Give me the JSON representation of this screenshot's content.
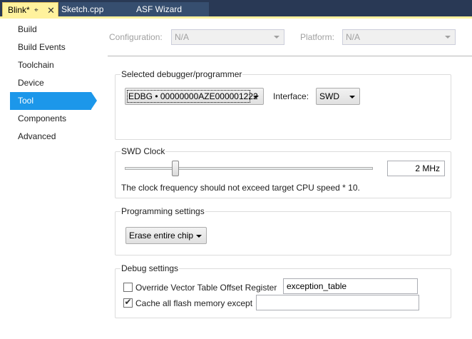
{
  "tabs": [
    {
      "label": "Blink*",
      "pin_icon": "pin-icon",
      "close_icon": "close-icon"
    },
    {
      "label": "Sketch.cpp"
    },
    {
      "label": "ASF Wizard"
    }
  ],
  "nav": {
    "items": [
      {
        "label": "Build"
      },
      {
        "label": "Build Events"
      },
      {
        "label": "Toolchain"
      },
      {
        "label": "Device"
      },
      {
        "label": "Tool"
      },
      {
        "label": "Components"
      },
      {
        "label": "Advanced"
      }
    ],
    "selected": "Tool"
  },
  "top": {
    "configuration_label": "Configuration:",
    "configuration_value": "N/A",
    "platform_label": "Platform:",
    "platform_value": "N/A"
  },
  "debugger": {
    "title": "Selected debugger/programmer",
    "value": "EDBG • 00000000AZE000001222",
    "interface_label": "Interface:",
    "interface_value": "SWD"
  },
  "swd_clock": {
    "title": "SWD Clock",
    "value": "2 MHz",
    "slider_fraction": 0.195,
    "note": "The clock frequency should not exceed target CPU speed * 10."
  },
  "programming": {
    "title": "Programming settings",
    "value": "Erase entire chip"
  },
  "debug": {
    "title": "Debug settings",
    "override_label": "Override Vector Table Offset Register",
    "override_checked": false,
    "override_value": "exception_table",
    "cache_label": "Cache all flash memory except",
    "cache_checked": true,
    "cache_value": ""
  },
  "colors": {
    "tab_bar": "#293955",
    "active_tab": "#fff29d",
    "selected_nav": "#1c97ea"
  }
}
